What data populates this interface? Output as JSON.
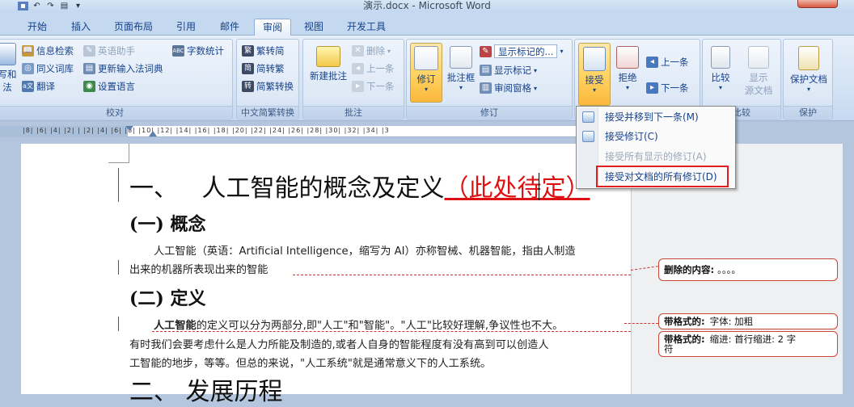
{
  "window": {
    "title": "演示.docx - Microsoft Word"
  },
  "tabs": [
    "开始",
    "插入",
    "页面布局",
    "引用",
    "邮件",
    "审阅",
    "视图",
    "开发工具"
  ],
  "active_tab": "审阅",
  "groups": {
    "proofing": {
      "label": "校对",
      "research": "信息检索",
      "english_assist": "英语助手",
      "word_count": "字数统计",
      "thesaurus": "同义词库",
      "update_ime": "更新输入法词典",
      "translate": "翻译",
      "set_language": "设置语言",
      "partial1": "写和",
      "partial2": "法"
    },
    "chinese": {
      "label": "中文简繁转换",
      "trad_to_simp": "繁转简",
      "simp_to_trad": "简转繁",
      "convert": "简繁转换"
    },
    "comments": {
      "label": "批注",
      "new": "新建批注",
      "delete": "删除",
      "prev": "上一条",
      "next": "下一条"
    },
    "tracking": {
      "label": "修订",
      "track": "修订",
      "balloons": "批注框",
      "display_dropdown": "显示标记的...",
      "show_markup": "显示标记",
      "reviewing_pane": "审阅窗格"
    },
    "changes": {
      "accept": "接受",
      "reject": "拒绝",
      "prev": "上一条",
      "next": "下一条"
    },
    "compare": {
      "label": "比较",
      "compare": "比较",
      "show_source": "显示",
      "show_source2": "源文档"
    },
    "protect": {
      "label": "保护",
      "protect_doc": "保护文档"
    }
  },
  "accept_menu": {
    "items": [
      "接受并移到下一条(M)",
      "接受修订(C)",
      "接受所有显示的修订(A)",
      "接受对文档的所有修订(D)"
    ],
    "disabled_index": 2,
    "highlighted_index": 3
  },
  "document": {
    "h1_prefix": "一、",
    "h1_main": "人工智能的概念及定义",
    "h1_insert": "（此处待定）",
    "h2_a": "(一) 概念",
    "p1_line1": "人工智能（英语：Artificial Intelligence，缩写为 AI）亦称智械、机器智能，指由人制造",
    "p1_line2": "出来的机器所表现出来的智能",
    "h2_b": "(二) 定义",
    "p2_bold": "人工智能",
    "p2_line1_rest": "的定义可以分为两部分,即\"人工\"和\"智能\"。\"人工\"比较好理解,争议性也不大。",
    "p2_line2": "有时我们会要考虑什么是人力所能及制造的,或者人自身的智能程度有没有高到可以创造人",
    "p2_line3": "工智能的地步，等等。但总的来说，\"人工系统\"就是通常意义下的人工系统。",
    "h1b": "二、 发展历程"
  },
  "balloons": {
    "deleted_label": "删除的内容:",
    "deleted_value": "。。。。",
    "fmt1_label": "带格式的:",
    "fmt1_value": "字体: 加粗",
    "fmt2_label": "带格式的:",
    "fmt2_value": "缩进: 首行缩进: 2 字",
    "fmt2_value2": "符"
  },
  "ruler": {
    "ticks": "|8| |6| |4| |2| | |2| |4| |6| |8| |10| |12| |14| |16| |18| |20| |22| |24| |26| |28| |30| |32| |34| |3"
  }
}
